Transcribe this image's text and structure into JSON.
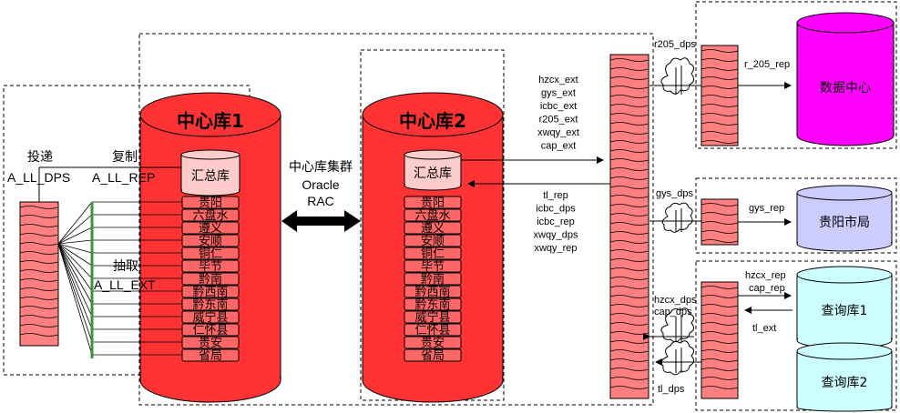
{
  "db1": {
    "title": "中心库1",
    "summary": "汇总库",
    "regions": [
      "贵阳",
      "六盘水",
      "遵义",
      "安顺",
      "铜仁",
      "毕节",
      "黔南",
      "黔西南",
      "黔东南",
      "威宁县",
      "仁怀县",
      "贵安",
      "省局"
    ]
  },
  "db2": {
    "title": "中心库2",
    "summary": "汇总库",
    "regions": [
      "贵阳",
      "六盘水",
      "遵义",
      "安顺",
      "铜仁",
      "毕节",
      "黔南",
      "黔西南",
      "黔东南",
      "威宁县",
      "仁怀县",
      "贵安",
      "省局"
    ]
  },
  "left": {
    "deliver": "投递",
    "deliver_process": "A_LL_DPS",
    "copy": "复制",
    "copy_process": "A_LL_REP",
    "extract": "抽取",
    "extract_process": "A_LL_EXT"
  },
  "cluster": {
    "line1": "中心库集群",
    "line2": "Oracle",
    "line3": "RAC"
  },
  "right_out_labels": [
    "hzcx_ext",
    "gys_ext",
    "icbc_ext",
    "r205_ext",
    "xwqy_ext",
    "cap_ext"
  ],
  "right_in_labels": [
    "tl_rep",
    "icbc_dps",
    "icbc_rep",
    "xwqy_dps",
    "xwqy_rep"
  ],
  "targets": {
    "data_center": {
      "name": "数据中心",
      "pump": "r205_dps",
      "rep": "r_205_rep",
      "color": "#ff00ff"
    },
    "guiyang": {
      "name": "贵阳市局",
      "pump": "gys_dps",
      "rep": "gys_rep",
      "color": "#ccccff"
    },
    "query": {
      "name1": "查询库1",
      "name2": "查询库2",
      "pump_line1": "hzcx_dps",
      "pump_line2": "cap_dps",
      "rep_line1": "hzcx_rep",
      "rep_line2": "cap_rep",
      "ext": "tl_ext",
      "tl_dps": "tl_dps",
      "color": "#ccffff"
    }
  },
  "colors": {
    "db_red": "#ff3333",
    "trail_pink": "#ff8080",
    "summary_pink": "#ffcccc",
    "line_green": "#339933"
  }
}
